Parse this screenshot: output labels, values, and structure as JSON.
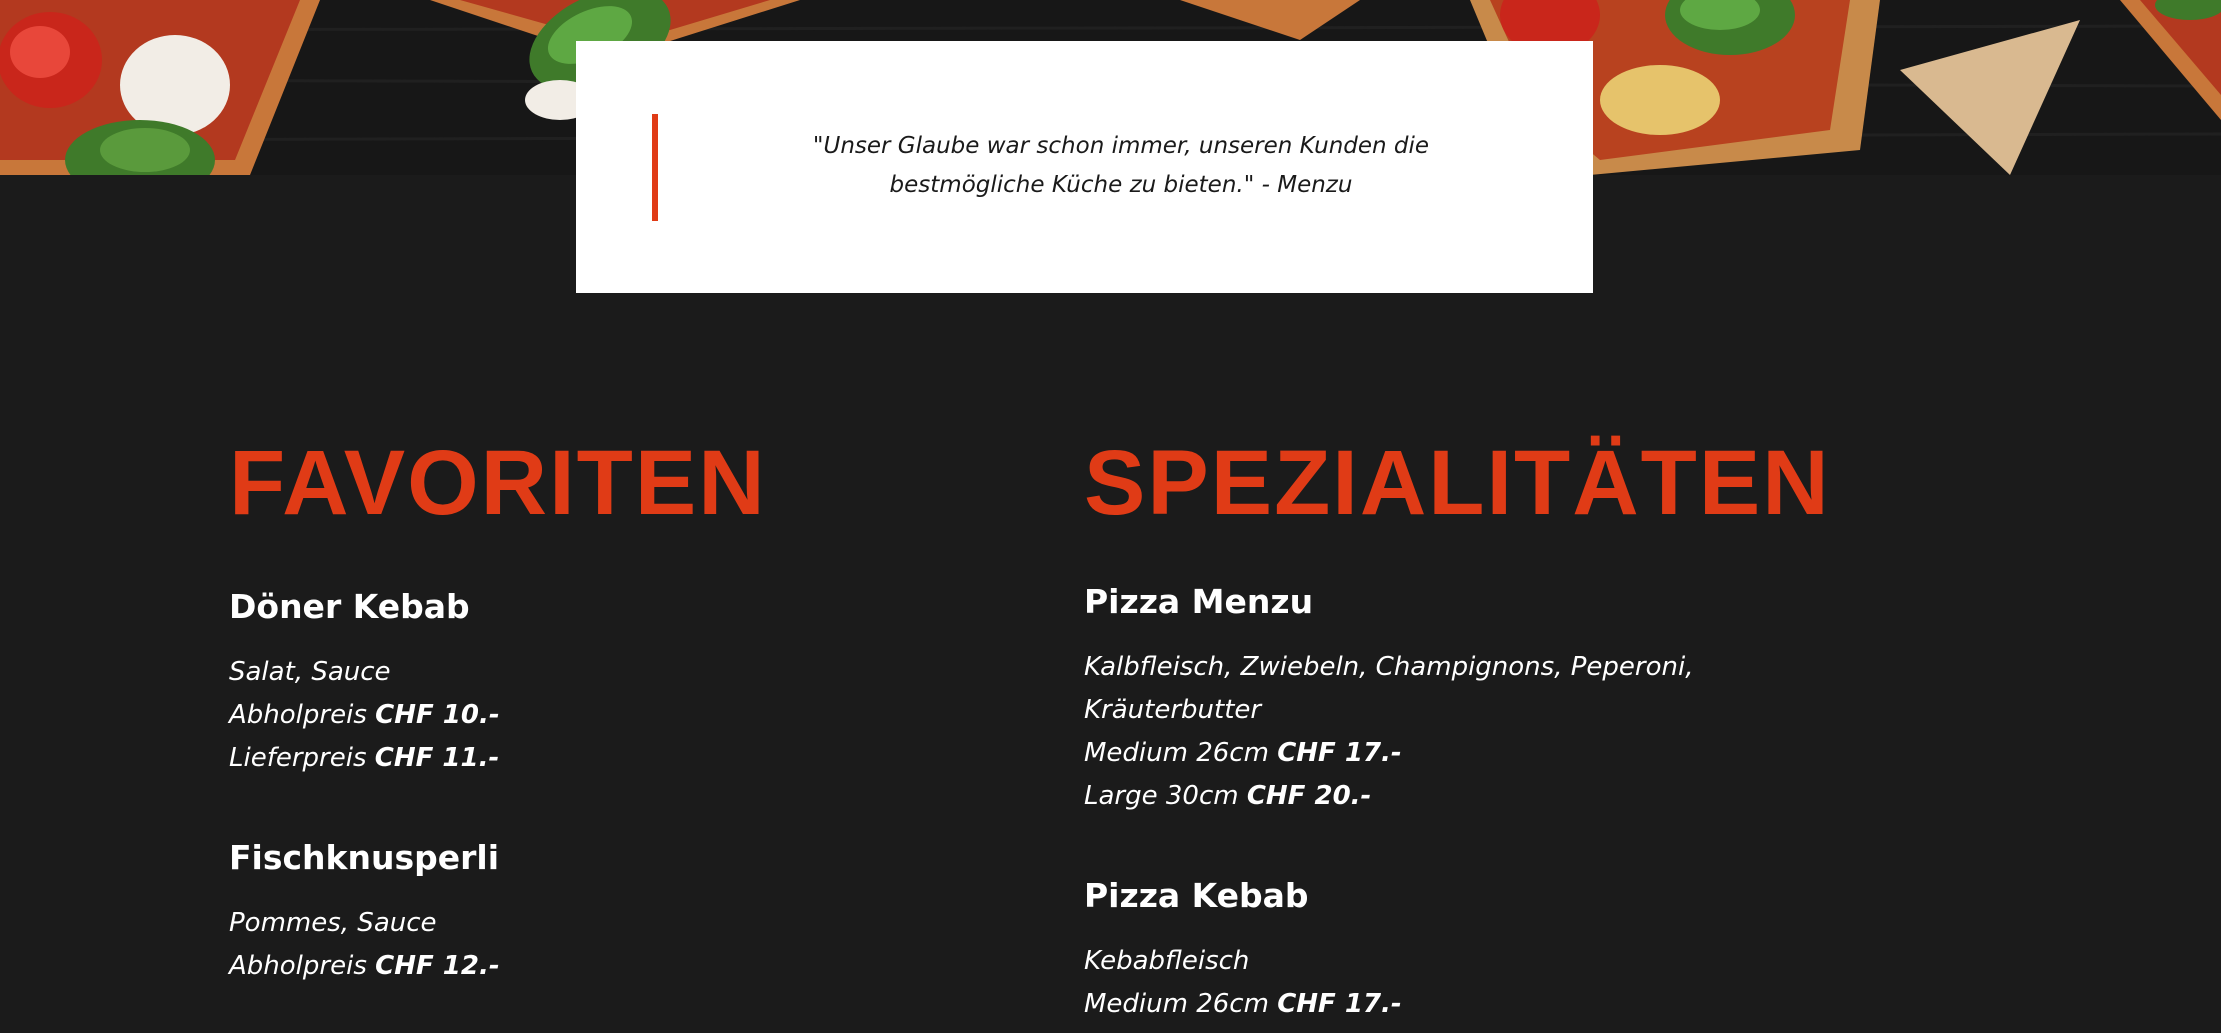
{
  "quote": {
    "text_line1": "\"Unser Glaube war schon immer, unseren Kunden die",
    "text_line2": "bestmögliche Küche zu bieten.\" - Menzu"
  },
  "colors": {
    "accent": "#e03b16",
    "background": "#1b1b1b",
    "card": "#ffffff",
    "text": "#ffffff"
  },
  "favoriten": {
    "title": "FAVORITEN",
    "items": [
      {
        "name": "Döner Kebab",
        "description": "Salat, Sauce",
        "pickup_label": "Abholpreis",
        "pickup_price": "CHF 10.-",
        "delivery_label": "Lieferpreis",
        "delivery_price": "CHF 11.-"
      },
      {
        "name": "Fischknusperli",
        "description": "Pommes, Sauce",
        "pickup_label": "Abholpreis",
        "pickup_price": "CHF 12.-"
      }
    ]
  },
  "spezialitaeten": {
    "title": "SPEZIALITÄTEN",
    "items": [
      {
        "name": "Pizza Menzu",
        "description_line1": "Kalbfleisch, Zwiebeln, Champignons, Peperoni,",
        "description_line2": "Kräuterbutter",
        "medium_label": "Medium 26cm",
        "medium_price": "CHF 17.-",
        "large_label": "Large 30cm",
        "large_price": "CHF 20.-"
      },
      {
        "name": "Pizza Kebab",
        "description": "Kebabfleisch",
        "medium_label": "Medium 26cm",
        "medium_price": "CHF 17.-"
      }
    ]
  }
}
